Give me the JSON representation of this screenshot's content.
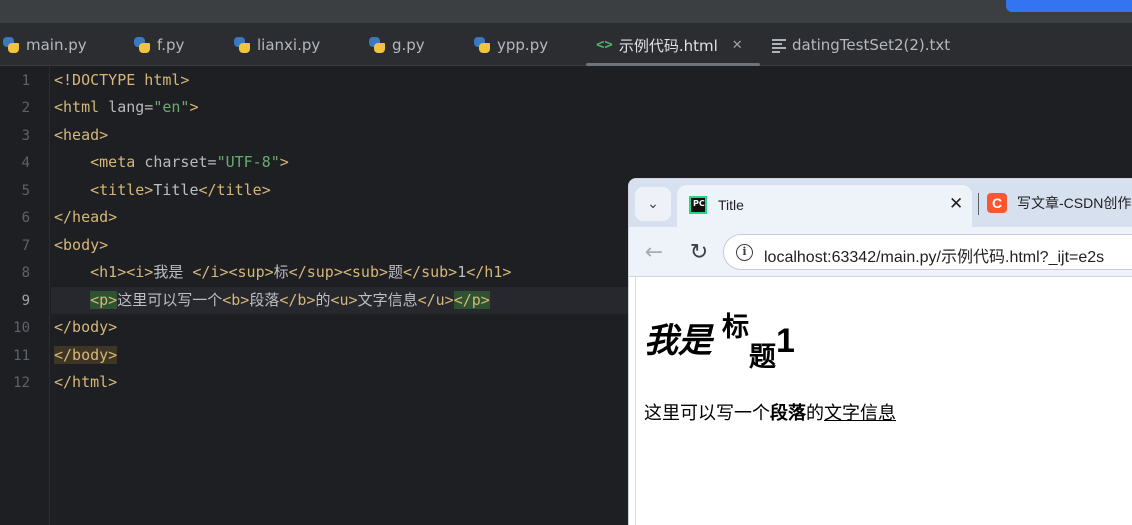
{
  "ide": {
    "tabs": [
      {
        "label": "main.py",
        "icon": "python-icon"
      },
      {
        "label": "f.py",
        "icon": "python-icon"
      },
      {
        "label": "lianxi.py",
        "icon": "python-icon"
      },
      {
        "label": "g.py",
        "icon": "python-icon"
      },
      {
        "label": "ypp.py",
        "icon": "python-icon"
      },
      {
        "label": "示例代码.html",
        "icon": "html-icon",
        "active": true
      },
      {
        "label": "datingTestSet2(2).txt",
        "icon": "text-file-icon"
      }
    ],
    "close_glyph": "✕",
    "html_icon_glyph": "<>",
    "line_numbers": [
      "1",
      "2",
      "3",
      "4",
      "5",
      "6",
      "7",
      "8",
      "9",
      "10",
      "11",
      "12"
    ],
    "current_line": "9",
    "code": {
      "l1": {
        "tag": "<!DOCTYPE html>"
      },
      "l2": {
        "open": "<html ",
        "attr": "lang=",
        "val": "\"en\"",
        "close": ">"
      },
      "l3": {
        "tag": "<head>"
      },
      "l4": {
        "open": "<meta ",
        "attr": "charset=",
        "val": "\"UTF-8\"",
        "close": ">"
      },
      "l5": {
        "t1": "<title>",
        "text": "Title",
        "t2": "</title>"
      },
      "l6": {
        "tag": "</head>"
      },
      "l7": {
        "tag": "<body>"
      },
      "l8": {
        "t1": "<h1><i>",
        "x1": "我是 ",
        "t2": "</i><sup>",
        "x2": "标",
        "t3": "</sup><sub>",
        "x3": "题",
        "t4": "</sub>",
        "x4": "1",
        "t5": "</h1>"
      },
      "l9": {
        "t1": "<p>",
        "x1": "这里可以写一个",
        "t2": "<b>",
        "x2": "段落",
        "t3": "</b>",
        "x3": "的",
        "t4": "<u>",
        "x4": "文字信息",
        "t5": "</u>",
        "t6": "</p>"
      },
      "l10": {
        "tag": "</body>"
      },
      "l11": {
        "tag": "</body>"
      },
      "l12": {
        "tag": "</html>"
      }
    }
  },
  "browser": {
    "tab_title": "Title",
    "tab_close": "✕",
    "tab_menu_glyph": "⌄",
    "other_tab_title": "写文章-CSDN创作",
    "other_tab_icon_letter": "C",
    "pc_icon_text": "PC",
    "back_glyph": "←",
    "reload_glyph": "↻",
    "info_glyph": "i",
    "url": "localhost:63342/main.py/示例代码.html?_ijt=e2s",
    "page": {
      "h1_italic": "我是",
      "h1_sup": "标",
      "h1_sub": "题",
      "h1_tail": "1",
      "p_text1": "这里可以写一个",
      "p_bold": "段落",
      "p_text2": "的",
      "p_underline": "文字信息"
    }
  }
}
